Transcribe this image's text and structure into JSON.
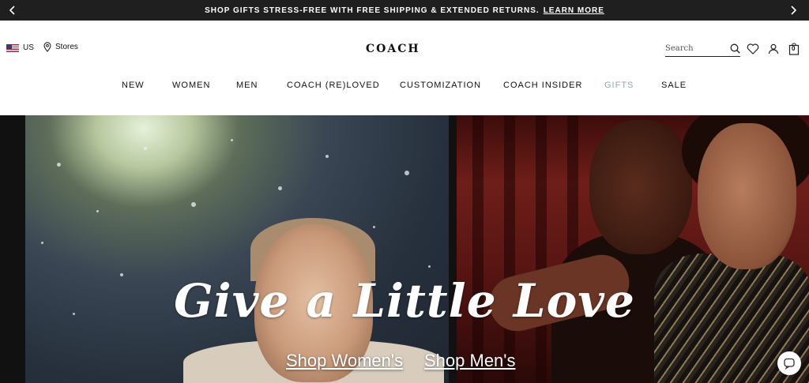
{
  "promo": {
    "text": "SHOP GIFTS STRESS-FREE WITH FREE SHIPPING & EXTENDED RETURNS.",
    "link": "LEARN MORE"
  },
  "header": {
    "locale": "US",
    "stores": "Stores",
    "logo": "COACH",
    "search_placeholder": "Search",
    "bag_count": "0"
  },
  "nav": {
    "items": [
      "NEW",
      "WOMEN",
      "MEN",
      "COACH (RE)LOVED",
      "CUSTOMIZATION",
      "COACH INSIDER",
      "GIFTS",
      "SALE"
    ]
  },
  "hero": {
    "headline": "Give a Little Love",
    "cta_women": "Shop Women's",
    "cta_men": "Shop Men's"
  },
  "colors": {
    "promo_bg": "#1f1f1f",
    "gifts_accent": "#8fa9ab"
  }
}
